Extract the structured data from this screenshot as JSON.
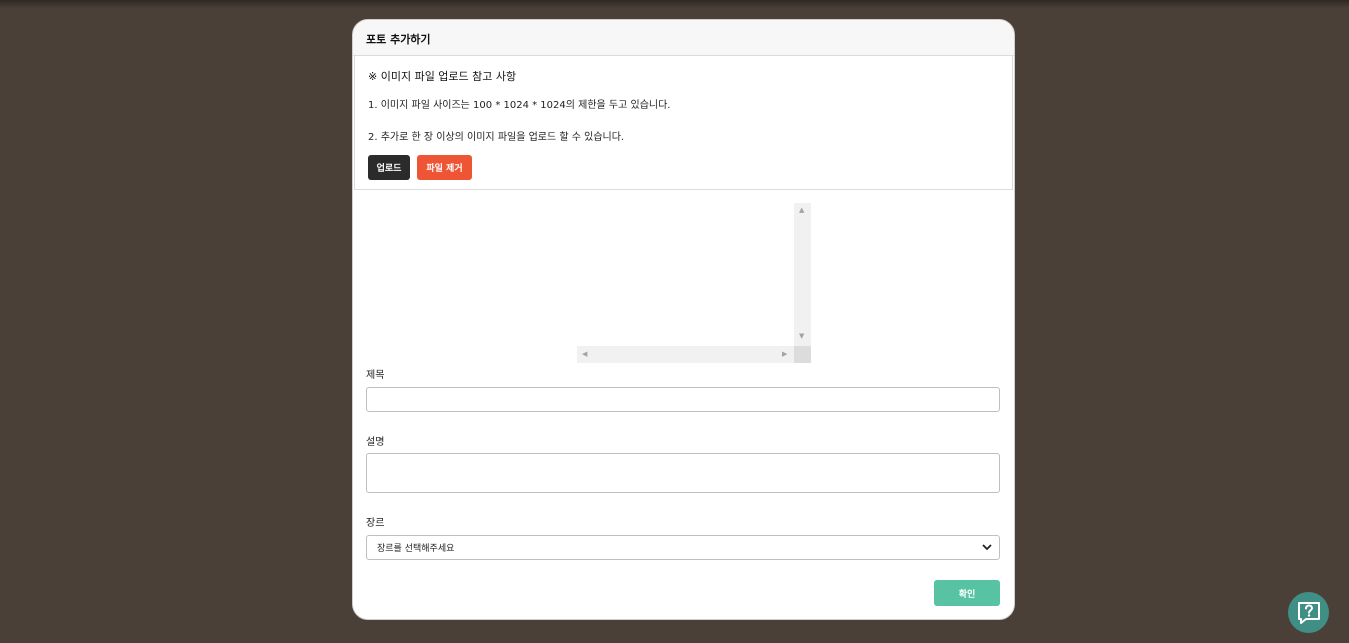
{
  "modal": {
    "title": "포토 추가하기"
  },
  "notice": {
    "title": "※ 이미지 파일 업로드 참고 사항",
    "line1": "1. 이미지 파일 사이즈는 100 * 1024 * 1024의 제한을 두고 있습니다.",
    "line2": "2. 추가로 한 장 이상의 이미지 파일을 업로드 할 수 있습니다."
  },
  "buttons": {
    "upload": "업로드",
    "remove": "파일 제거",
    "confirm": "확인"
  },
  "form": {
    "title_label": "제목",
    "title_value": "",
    "description_label": "설명",
    "description_value": "",
    "genre_label": "장르",
    "genre_selected": "장르를 선택해주세요"
  },
  "icons": {
    "help": "help-chat-icon",
    "select_chevron": "chevron-down-icon"
  },
  "colors": {
    "background": "#4a4037",
    "upload_button": "#2b2b2b",
    "remove_button": "#ee5535",
    "confirm_button": "#57c3a2",
    "help_button": "#3f8f86"
  }
}
